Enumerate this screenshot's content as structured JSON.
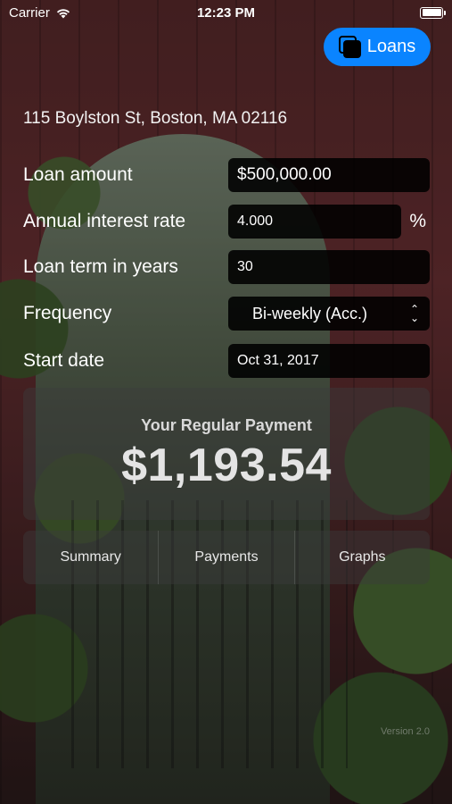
{
  "status_bar": {
    "carrier": "Carrier",
    "time": "12:23 PM"
  },
  "header": {
    "loans_button_label": "Loans"
  },
  "address": "115 Boylston St, Boston, MA 02116",
  "form": {
    "loan_amount": {
      "label": "Loan amount",
      "value": "$500,000.00"
    },
    "interest_rate": {
      "label": "Annual interest rate",
      "value": "4.000",
      "unit": "%"
    },
    "loan_term": {
      "label": "Loan term in years",
      "value": "30"
    },
    "frequency": {
      "label": "Frequency",
      "value": "Bi-weekly (Acc.)"
    },
    "start_date": {
      "label": "Start date",
      "value": "Oct 31, 2017"
    }
  },
  "payment": {
    "title": "Your Regular Payment",
    "amount": "$1,193.54"
  },
  "tabs": [
    "Summary",
    "Payments",
    "Graphs"
  ],
  "version": "Version 2.0",
  "colors": {
    "accent": "#0a84ff",
    "field_bg": "#000000"
  }
}
